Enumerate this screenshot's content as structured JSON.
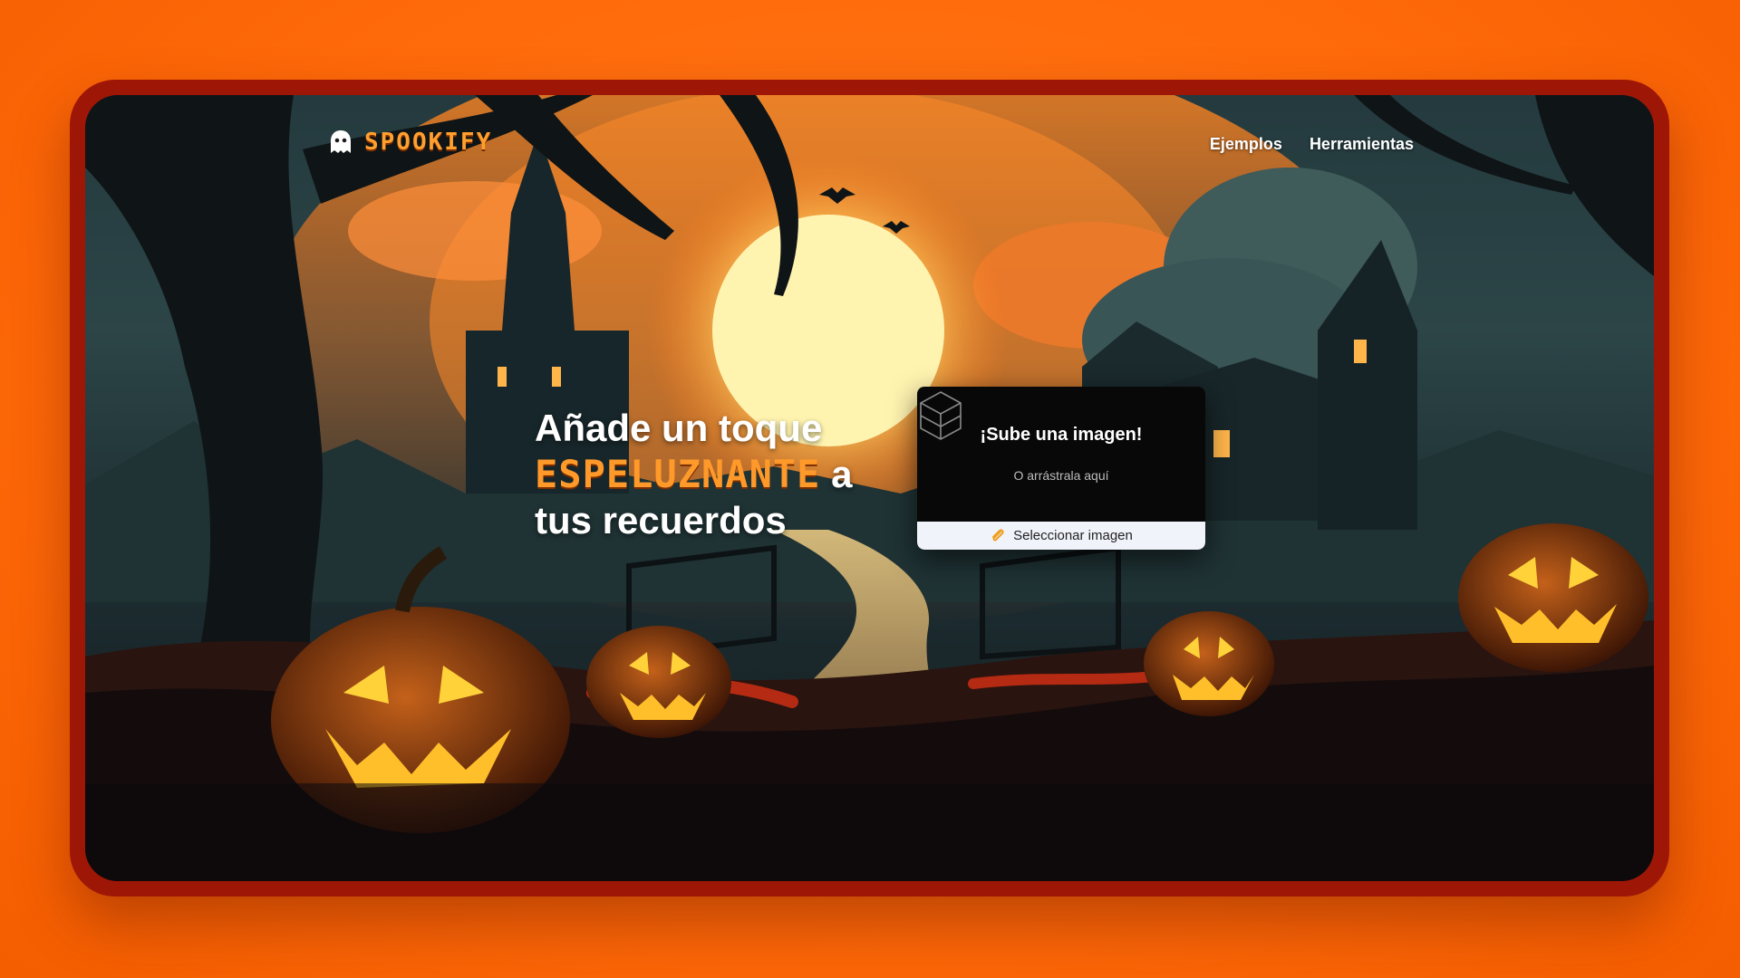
{
  "brand": {
    "name": "SPOOKIFY"
  },
  "nav": {
    "items": [
      {
        "label": "Ejemplos"
      },
      {
        "label": "Herramientas"
      }
    ]
  },
  "hero": {
    "line1": "Añade un toque",
    "highlight": "ESPELUZNANTE",
    "connector": "a",
    "line3": "tus recuerdos"
  },
  "upload": {
    "title": "¡Sube una imagen!",
    "subtitle": "O arrástrala aquí",
    "button_label": "Seleccionar imagen",
    "button_icon": "paperclip-icon"
  },
  "colors": {
    "page_bg": "#ff6a0a",
    "frame": "#9e1606",
    "accent": "#ff9a2a",
    "card_bg": "#080808",
    "button_bg": "#f1f3fb"
  }
}
